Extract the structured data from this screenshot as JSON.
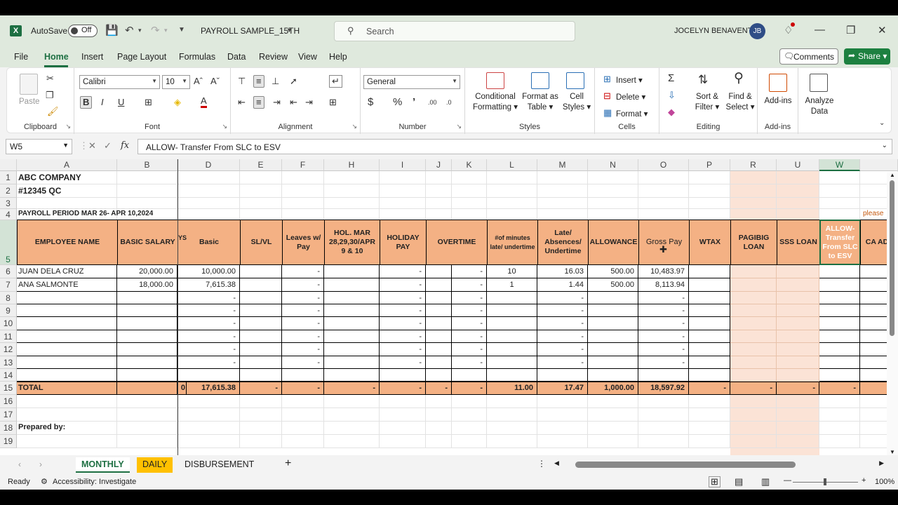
{
  "titlebar": {
    "autosave_label": "AutoSave",
    "autosave_state": "Off",
    "filename": "PAYROLL SAMPLE_15TH",
    "search_placeholder": "Search",
    "user_name": "JOCELYN BENAVENTE",
    "user_initials": "JB"
  },
  "menu": {
    "items": [
      "File",
      "Home",
      "Insert",
      "Page Layout",
      "Formulas",
      "Data",
      "Review",
      "View",
      "Help"
    ],
    "active": "Home",
    "comments_label": "Comments",
    "share_label": "Share"
  },
  "ribbon": {
    "clipboard": {
      "label": "Clipboard",
      "paste": "Paste"
    },
    "font": {
      "label": "Font",
      "family": "Calibri",
      "size": "10"
    },
    "alignment": {
      "label": "Alignment"
    },
    "number": {
      "label": "Number",
      "format": "General"
    },
    "styles": {
      "label": "Styles",
      "conditional": "Conditional",
      "conditional2": "Formatting",
      "format_as": "Format as",
      "format_as2": "Table",
      "cell": "Cell",
      "cell2": "Styles"
    },
    "cells": {
      "label": "Cells",
      "insert": "Insert",
      "delete": "Delete",
      "format": "Format"
    },
    "editing": {
      "label": "Editing",
      "sort": "Sort &",
      "sort2": "Filter",
      "find": "Find &",
      "find2": "Select"
    },
    "addins": {
      "label": "Add-ins",
      "addins_btn": "Add-ins",
      "analyze": "Analyze",
      "analyze2": "Data"
    }
  },
  "formula_bar": {
    "name_box": "W5",
    "formula": "ALLOW- Transfer From SLC to ESV"
  },
  "sheet": {
    "columns": [
      "A",
      "B",
      "D",
      "E",
      "F",
      "H",
      "I",
      "J",
      "K",
      "L",
      "M",
      "N",
      "O",
      "P",
      "R",
      "U",
      "W"
    ],
    "rows": [
      "1",
      "2",
      "3",
      "4",
      "5",
      "6",
      "7",
      "8",
      "9",
      "10",
      "11",
      "12",
      "13",
      "14",
      "15",
      "16",
      "17",
      "18",
      "19"
    ],
    "company": "ABC COMPANY",
    "address": "#12345 QC",
    "period": "PAYROLL PERIOD MAR 26- APR 10,2024",
    "please_note": "please",
    "hidden_col_fragment": "YS",
    "headers": {
      "employee": "EMPLOYEE NAME",
      "basic_salary": "BASIC SALARY",
      "basic": "Basic",
      "slvl": "SL/VL",
      "leaves": "Leaves w/ Pay",
      "hol_mar": "HOL. MAR 28,29,30/APR 9 & 10",
      "holiday": "HOLIDAY PAY",
      "overtime": "OVERTIME",
      "minutes": "#of minutes late/ undertime",
      "late": "Late/ Absences/ Undertime",
      "allowance": "ALLOWANCE",
      "gross": "Gross Pay",
      "wtax": "WTAX",
      "pagibig": "PAGIBIG LOAN",
      "sss": "SSS LOAN",
      "allow_transfer": "ALLOW- Transfer From SLC to ESV",
      "cash_adv": "CA ADV"
    },
    "employees": [
      {
        "name": "JUAN DELA CRUZ",
        "basic_salary": "20,000.00",
        "basic": "10,000.00",
        "leaves": "-",
        "holiday": "-",
        "ot": "-",
        "minutes": "10",
        "late": "16.03",
        "allowance": "500.00",
        "gross": "10,483.97"
      },
      {
        "name": "ANA SALMONTE",
        "basic_salary": "18,000.00",
        "basic": "7,615.38",
        "leaves": "-",
        "holiday": "-",
        "ot": "-",
        "minutes": "1",
        "late": "1.44",
        "allowance": "500.00",
        "gross": "8,113.94"
      }
    ],
    "dash": "-",
    "total": {
      "label": "TOTAL",
      "b_fragment": "0",
      "basic": "17,615.38",
      "slvl": "-",
      "leaves": "-",
      "hol": "-",
      "holiday": "-",
      "ot1": "-",
      "ot2": "-",
      "minutes": "11.00",
      "late": "17.47",
      "allowance": "1,000.00",
      "gross": "18,597.92",
      "wtax": "-",
      "pagibig": "-",
      "sss": "-",
      "allow": "-"
    },
    "prepared_by": "Prepared by:"
  },
  "sheet_tabs": [
    "MONTHLY",
    "DAILY",
    "DISBURSEMENT"
  ],
  "status": {
    "ready": "Ready",
    "accessibility": "Accessibility: Investigate",
    "zoom": "100%"
  },
  "colors": {
    "excel_green": "#1d6f42",
    "header_orange": "#f4b184",
    "band_peach": "#fbe3d6",
    "daily_tab": "#ffc000"
  }
}
